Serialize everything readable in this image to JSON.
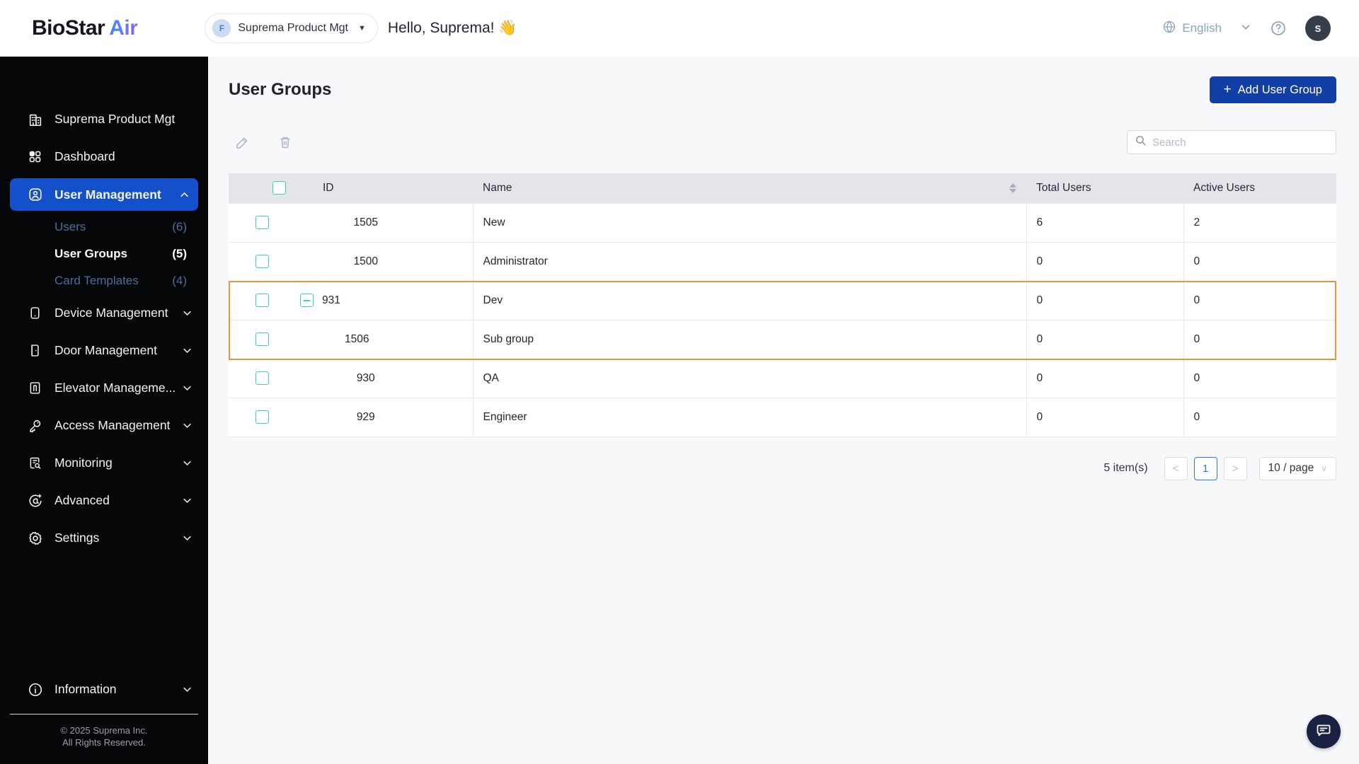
{
  "header": {
    "logo_part1": "BioStar",
    "logo_part2": "Air",
    "org_selector": {
      "badge": "F",
      "label": "Suprema Product Mgt"
    },
    "greeting": "Hello, Suprema! 👋",
    "language": "English",
    "avatar_initial": "S"
  },
  "sidebar": {
    "items": [
      {
        "label": "Suprema Product Mgt"
      },
      {
        "label": "Dashboard"
      },
      {
        "label": "User Management"
      },
      {
        "label": "Device Management"
      },
      {
        "label": "Door Management"
      },
      {
        "label": "Elevator Manageme..."
      },
      {
        "label": "Access Management"
      },
      {
        "label": "Monitoring"
      },
      {
        "label": "Advanced"
      },
      {
        "label": "Settings"
      },
      {
        "label": "Information"
      }
    ],
    "sub_items": [
      {
        "label": "Users",
        "count": "(6)"
      },
      {
        "label": "User Groups",
        "count": "(5)"
      },
      {
        "label": "Card Templates",
        "count": "(4)"
      }
    ],
    "copyright_line1": "© 2025 Suprema Inc.",
    "copyright_line2": "All Rights Reserved."
  },
  "main": {
    "title": "User Groups",
    "add_button_plus": "+",
    "add_button_label": "Add User Group",
    "search_placeholder": "Search",
    "table": {
      "columns": {
        "id": "ID",
        "name": "Name",
        "total": "Total Users",
        "active": "Active Users"
      },
      "rows": [
        {
          "id": "1505",
          "name": "New",
          "total": "6",
          "active": "2"
        },
        {
          "id": "1500",
          "name": "Administrator",
          "total": "0",
          "active": "0"
        },
        {
          "id": "931",
          "name": "Dev",
          "total": "0",
          "active": "0"
        },
        {
          "id": "1506",
          "name": "Sub group",
          "total": "0",
          "active": "0"
        },
        {
          "id": "930",
          "name": "QA",
          "total": "0",
          "active": "0"
        },
        {
          "id": "929",
          "name": "Engineer",
          "total": "0",
          "active": "0"
        }
      ]
    },
    "pagination": {
      "items_text": "5 item(s)",
      "prev": "<",
      "page": "1",
      "next": ">",
      "page_size": "10 / page"
    }
  },
  "colors": {
    "sidebar_active_blue": "#1550cb",
    "button_blue": "#123fa6",
    "checkbox_teal": "#38d4aa",
    "highlight_orange": "#e2993b",
    "page_current_blue": "#2f76e9"
  }
}
